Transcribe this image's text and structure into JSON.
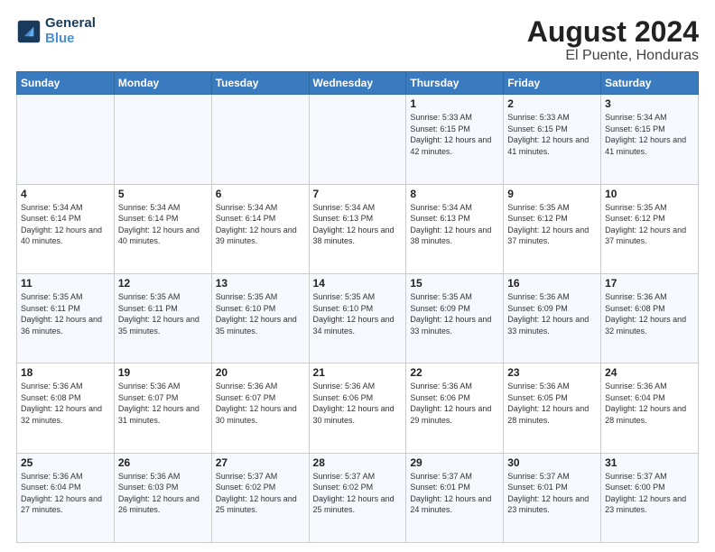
{
  "logo": {
    "line1": "General",
    "line2": "Blue"
  },
  "title": "August 2024",
  "subtitle": "El Puente, Honduras",
  "days_of_week": [
    "Sunday",
    "Monday",
    "Tuesday",
    "Wednesday",
    "Thursday",
    "Friday",
    "Saturday"
  ],
  "weeks": [
    [
      {
        "day": "",
        "sunrise": "",
        "sunset": "",
        "daylight": ""
      },
      {
        "day": "",
        "sunrise": "",
        "sunset": "",
        "daylight": ""
      },
      {
        "day": "",
        "sunrise": "",
        "sunset": "",
        "daylight": ""
      },
      {
        "day": "",
        "sunrise": "",
        "sunset": "",
        "daylight": ""
      },
      {
        "day": "1",
        "sunrise": "Sunrise: 5:33 AM",
        "sunset": "Sunset: 6:15 PM",
        "daylight": "Daylight: 12 hours and 42 minutes."
      },
      {
        "day": "2",
        "sunrise": "Sunrise: 5:33 AM",
        "sunset": "Sunset: 6:15 PM",
        "daylight": "Daylight: 12 hours and 41 minutes."
      },
      {
        "day": "3",
        "sunrise": "Sunrise: 5:34 AM",
        "sunset": "Sunset: 6:15 PM",
        "daylight": "Daylight: 12 hours and 41 minutes."
      }
    ],
    [
      {
        "day": "4",
        "sunrise": "Sunrise: 5:34 AM",
        "sunset": "Sunset: 6:14 PM",
        "daylight": "Daylight: 12 hours and 40 minutes."
      },
      {
        "day": "5",
        "sunrise": "Sunrise: 5:34 AM",
        "sunset": "Sunset: 6:14 PM",
        "daylight": "Daylight: 12 hours and 40 minutes."
      },
      {
        "day": "6",
        "sunrise": "Sunrise: 5:34 AM",
        "sunset": "Sunset: 6:14 PM",
        "daylight": "Daylight: 12 hours and 39 minutes."
      },
      {
        "day": "7",
        "sunrise": "Sunrise: 5:34 AM",
        "sunset": "Sunset: 6:13 PM",
        "daylight": "Daylight: 12 hours and 38 minutes."
      },
      {
        "day": "8",
        "sunrise": "Sunrise: 5:34 AM",
        "sunset": "Sunset: 6:13 PM",
        "daylight": "Daylight: 12 hours and 38 minutes."
      },
      {
        "day": "9",
        "sunrise": "Sunrise: 5:35 AM",
        "sunset": "Sunset: 6:12 PM",
        "daylight": "Daylight: 12 hours and 37 minutes."
      },
      {
        "day": "10",
        "sunrise": "Sunrise: 5:35 AM",
        "sunset": "Sunset: 6:12 PM",
        "daylight": "Daylight: 12 hours and 37 minutes."
      }
    ],
    [
      {
        "day": "11",
        "sunrise": "Sunrise: 5:35 AM",
        "sunset": "Sunset: 6:11 PM",
        "daylight": "Daylight: 12 hours and 36 minutes."
      },
      {
        "day": "12",
        "sunrise": "Sunrise: 5:35 AM",
        "sunset": "Sunset: 6:11 PM",
        "daylight": "Daylight: 12 hours and 35 minutes."
      },
      {
        "day": "13",
        "sunrise": "Sunrise: 5:35 AM",
        "sunset": "Sunset: 6:10 PM",
        "daylight": "Daylight: 12 hours and 35 minutes."
      },
      {
        "day": "14",
        "sunrise": "Sunrise: 5:35 AM",
        "sunset": "Sunset: 6:10 PM",
        "daylight": "Daylight: 12 hours and 34 minutes."
      },
      {
        "day": "15",
        "sunrise": "Sunrise: 5:35 AM",
        "sunset": "Sunset: 6:09 PM",
        "daylight": "Daylight: 12 hours and 33 minutes."
      },
      {
        "day": "16",
        "sunrise": "Sunrise: 5:36 AM",
        "sunset": "Sunset: 6:09 PM",
        "daylight": "Daylight: 12 hours and 33 minutes."
      },
      {
        "day": "17",
        "sunrise": "Sunrise: 5:36 AM",
        "sunset": "Sunset: 6:08 PM",
        "daylight": "Daylight: 12 hours and 32 minutes."
      }
    ],
    [
      {
        "day": "18",
        "sunrise": "Sunrise: 5:36 AM",
        "sunset": "Sunset: 6:08 PM",
        "daylight": "Daylight: 12 hours and 32 minutes."
      },
      {
        "day": "19",
        "sunrise": "Sunrise: 5:36 AM",
        "sunset": "Sunset: 6:07 PM",
        "daylight": "Daylight: 12 hours and 31 minutes."
      },
      {
        "day": "20",
        "sunrise": "Sunrise: 5:36 AM",
        "sunset": "Sunset: 6:07 PM",
        "daylight": "Daylight: 12 hours and 30 minutes."
      },
      {
        "day": "21",
        "sunrise": "Sunrise: 5:36 AM",
        "sunset": "Sunset: 6:06 PM",
        "daylight": "Daylight: 12 hours and 30 minutes."
      },
      {
        "day": "22",
        "sunrise": "Sunrise: 5:36 AM",
        "sunset": "Sunset: 6:06 PM",
        "daylight": "Daylight: 12 hours and 29 minutes."
      },
      {
        "day": "23",
        "sunrise": "Sunrise: 5:36 AM",
        "sunset": "Sunset: 6:05 PM",
        "daylight": "Daylight: 12 hours and 28 minutes."
      },
      {
        "day": "24",
        "sunrise": "Sunrise: 5:36 AM",
        "sunset": "Sunset: 6:04 PM",
        "daylight": "Daylight: 12 hours and 28 minutes."
      }
    ],
    [
      {
        "day": "25",
        "sunrise": "Sunrise: 5:36 AM",
        "sunset": "Sunset: 6:04 PM",
        "daylight": "Daylight: 12 hours and 27 minutes."
      },
      {
        "day": "26",
        "sunrise": "Sunrise: 5:36 AM",
        "sunset": "Sunset: 6:03 PM",
        "daylight": "Daylight: 12 hours and 26 minutes."
      },
      {
        "day": "27",
        "sunrise": "Sunrise: 5:37 AM",
        "sunset": "Sunset: 6:02 PM",
        "daylight": "Daylight: 12 hours and 25 minutes."
      },
      {
        "day": "28",
        "sunrise": "Sunrise: 5:37 AM",
        "sunset": "Sunset: 6:02 PM",
        "daylight": "Daylight: 12 hours and 25 minutes."
      },
      {
        "day": "29",
        "sunrise": "Sunrise: 5:37 AM",
        "sunset": "Sunset: 6:01 PM",
        "daylight": "Daylight: 12 hours and 24 minutes."
      },
      {
        "day": "30",
        "sunrise": "Sunrise: 5:37 AM",
        "sunset": "Sunset: 6:01 PM",
        "daylight": "Daylight: 12 hours and 23 minutes."
      },
      {
        "day": "31",
        "sunrise": "Sunrise: 5:37 AM",
        "sunset": "Sunset: 6:00 PM",
        "daylight": "Daylight: 12 hours and 23 minutes."
      }
    ]
  ]
}
